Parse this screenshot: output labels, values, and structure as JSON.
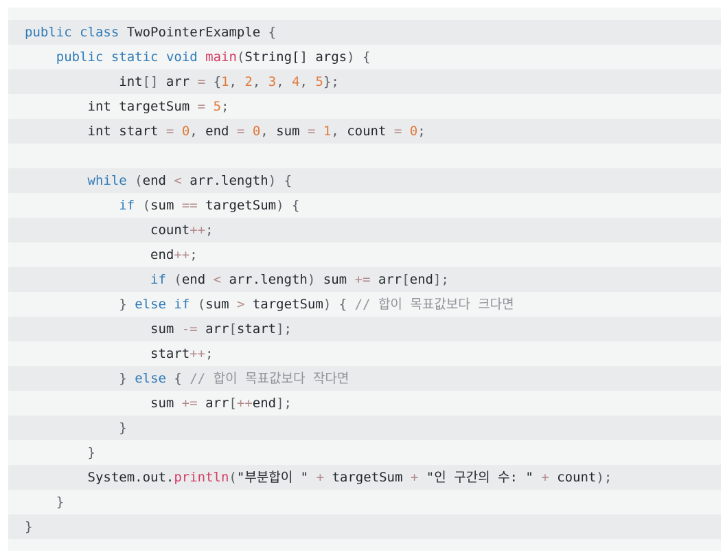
{
  "colors": {
    "background": "#f4f5f5",
    "shaded_line": "#eaebec",
    "keyword": "#2f7bb8",
    "function": "#d23c64",
    "number": "#e07a3c",
    "operator": "#b48a8a",
    "punctuation": "#5b6168",
    "comment": "#8f959b",
    "text": "#24292e"
  },
  "code": {
    "language": "java",
    "lines": [
      [
        {
          "t": "keyword",
          "v": "public"
        },
        {
          "t": "ident",
          "v": " "
        },
        {
          "t": "keyword",
          "v": "class"
        },
        {
          "t": "ident",
          "v": " TwoPointerExample "
        },
        {
          "t": "punct",
          "v": "{"
        }
      ],
      [
        {
          "t": "ident",
          "v": "    "
        },
        {
          "t": "keyword",
          "v": "public"
        },
        {
          "t": "ident",
          "v": " "
        },
        {
          "t": "keyword",
          "v": "static"
        },
        {
          "t": "ident",
          "v": " "
        },
        {
          "t": "keyword",
          "v": "void"
        },
        {
          "t": "ident",
          "v": " "
        },
        {
          "t": "func",
          "v": "main"
        },
        {
          "t": "punct",
          "v": "("
        },
        {
          "t": "ident",
          "v": "String[] args"
        },
        {
          "t": "punct",
          "v": ")"
        },
        {
          "t": "ident",
          "v": " "
        },
        {
          "t": "punct",
          "v": "{"
        }
      ],
      [
        {
          "t": "ident",
          "v": "            int"
        },
        {
          "t": "punct",
          "v": "[]"
        },
        {
          "t": "ident",
          "v": " arr "
        },
        {
          "t": "op",
          "v": "="
        },
        {
          "t": "ident",
          "v": " "
        },
        {
          "t": "punct",
          "v": "{"
        },
        {
          "t": "number",
          "v": "1"
        },
        {
          "t": "punct",
          "v": ", "
        },
        {
          "t": "number",
          "v": "2"
        },
        {
          "t": "punct",
          "v": ", "
        },
        {
          "t": "number",
          "v": "3"
        },
        {
          "t": "punct",
          "v": ", "
        },
        {
          "t": "number",
          "v": "4"
        },
        {
          "t": "punct",
          "v": ", "
        },
        {
          "t": "number",
          "v": "5"
        },
        {
          "t": "punct",
          "v": "};"
        }
      ],
      [
        {
          "t": "ident",
          "v": "        int targetSum "
        },
        {
          "t": "op",
          "v": "="
        },
        {
          "t": "ident",
          "v": " "
        },
        {
          "t": "number",
          "v": "5"
        },
        {
          "t": "punct",
          "v": ";"
        }
      ],
      [
        {
          "t": "ident",
          "v": "        int start "
        },
        {
          "t": "op",
          "v": "="
        },
        {
          "t": "ident",
          "v": " "
        },
        {
          "t": "number",
          "v": "0"
        },
        {
          "t": "punct",
          "v": ","
        },
        {
          "t": "ident",
          "v": " end "
        },
        {
          "t": "op",
          "v": "="
        },
        {
          "t": "ident",
          "v": " "
        },
        {
          "t": "number",
          "v": "0"
        },
        {
          "t": "punct",
          "v": ","
        },
        {
          "t": "ident",
          "v": " sum "
        },
        {
          "t": "op",
          "v": "="
        },
        {
          "t": "ident",
          "v": " "
        },
        {
          "t": "number",
          "v": "1"
        },
        {
          "t": "punct",
          "v": ","
        },
        {
          "t": "ident",
          "v": " count "
        },
        {
          "t": "op",
          "v": "="
        },
        {
          "t": "ident",
          "v": " "
        },
        {
          "t": "number",
          "v": "0"
        },
        {
          "t": "punct",
          "v": ";"
        }
      ],
      [],
      [
        {
          "t": "ident",
          "v": "        "
        },
        {
          "t": "keyword",
          "v": "while"
        },
        {
          "t": "ident",
          "v": " "
        },
        {
          "t": "punct",
          "v": "("
        },
        {
          "t": "ident",
          "v": "end "
        },
        {
          "t": "op",
          "v": "<"
        },
        {
          "t": "ident",
          "v": " arr.length"
        },
        {
          "t": "punct",
          "v": ")"
        },
        {
          "t": "ident",
          "v": " "
        },
        {
          "t": "punct",
          "v": "{"
        }
      ],
      [
        {
          "t": "ident",
          "v": "            "
        },
        {
          "t": "keyword",
          "v": "if"
        },
        {
          "t": "ident",
          "v": " "
        },
        {
          "t": "punct",
          "v": "("
        },
        {
          "t": "ident",
          "v": "sum "
        },
        {
          "t": "op",
          "v": "=="
        },
        {
          "t": "ident",
          "v": " targetSum"
        },
        {
          "t": "punct",
          "v": ")"
        },
        {
          "t": "ident",
          "v": " "
        },
        {
          "t": "punct",
          "v": "{"
        }
      ],
      [
        {
          "t": "ident",
          "v": "                count"
        },
        {
          "t": "op",
          "v": "++"
        },
        {
          "t": "punct",
          "v": ";"
        }
      ],
      [
        {
          "t": "ident",
          "v": "                end"
        },
        {
          "t": "op",
          "v": "++"
        },
        {
          "t": "punct",
          "v": ";"
        }
      ],
      [
        {
          "t": "ident",
          "v": "                "
        },
        {
          "t": "keyword",
          "v": "if"
        },
        {
          "t": "ident",
          "v": " "
        },
        {
          "t": "punct",
          "v": "("
        },
        {
          "t": "ident",
          "v": "end "
        },
        {
          "t": "op",
          "v": "<"
        },
        {
          "t": "ident",
          "v": " arr.length"
        },
        {
          "t": "punct",
          "v": ")"
        },
        {
          "t": "ident",
          "v": " sum "
        },
        {
          "t": "op",
          "v": "+="
        },
        {
          "t": "ident",
          "v": " arr"
        },
        {
          "t": "punct",
          "v": "["
        },
        {
          "t": "ident",
          "v": "end"
        },
        {
          "t": "punct",
          "v": "];"
        }
      ],
      [
        {
          "t": "ident",
          "v": "            "
        },
        {
          "t": "punct",
          "v": "}"
        },
        {
          "t": "ident",
          "v": " "
        },
        {
          "t": "keyword",
          "v": "else"
        },
        {
          "t": "ident",
          "v": " "
        },
        {
          "t": "keyword",
          "v": "if"
        },
        {
          "t": "ident",
          "v": " "
        },
        {
          "t": "punct",
          "v": "("
        },
        {
          "t": "ident",
          "v": "sum "
        },
        {
          "t": "op",
          "v": ">"
        },
        {
          "t": "ident",
          "v": " targetSum"
        },
        {
          "t": "punct",
          "v": ")"
        },
        {
          "t": "ident",
          "v": " "
        },
        {
          "t": "punct",
          "v": "{"
        },
        {
          "t": "ident",
          "v": " "
        },
        {
          "t": "comment",
          "v": "// 합이 목표값보다 크다면"
        }
      ],
      [
        {
          "t": "ident",
          "v": "                sum "
        },
        {
          "t": "op",
          "v": "-="
        },
        {
          "t": "ident",
          "v": " arr"
        },
        {
          "t": "punct",
          "v": "["
        },
        {
          "t": "ident",
          "v": "start"
        },
        {
          "t": "punct",
          "v": "];"
        }
      ],
      [
        {
          "t": "ident",
          "v": "                start"
        },
        {
          "t": "op",
          "v": "++"
        },
        {
          "t": "punct",
          "v": ";"
        }
      ],
      [
        {
          "t": "ident",
          "v": "            "
        },
        {
          "t": "punct",
          "v": "}"
        },
        {
          "t": "ident",
          "v": " "
        },
        {
          "t": "keyword",
          "v": "else"
        },
        {
          "t": "ident",
          "v": " "
        },
        {
          "t": "punct",
          "v": "{"
        },
        {
          "t": "ident",
          "v": " "
        },
        {
          "t": "comment",
          "v": "// 합이 목표값보다 작다면"
        }
      ],
      [
        {
          "t": "ident",
          "v": "                sum "
        },
        {
          "t": "op",
          "v": "+="
        },
        {
          "t": "ident",
          "v": " arr"
        },
        {
          "t": "punct",
          "v": "["
        },
        {
          "t": "op",
          "v": "++"
        },
        {
          "t": "ident",
          "v": "end"
        },
        {
          "t": "punct",
          "v": "];"
        }
      ],
      [
        {
          "t": "ident",
          "v": "            "
        },
        {
          "t": "punct",
          "v": "}"
        }
      ],
      [
        {
          "t": "ident",
          "v": "        "
        },
        {
          "t": "punct",
          "v": "}"
        }
      ],
      [
        {
          "t": "ident",
          "v": "        System.out."
        },
        {
          "t": "func",
          "v": "println"
        },
        {
          "t": "punct",
          "v": "("
        },
        {
          "t": "string",
          "v": "\"부분합이 \""
        },
        {
          "t": "ident",
          "v": " "
        },
        {
          "t": "op",
          "v": "+"
        },
        {
          "t": "ident",
          "v": " targetSum "
        },
        {
          "t": "op",
          "v": "+"
        },
        {
          "t": "ident",
          "v": " "
        },
        {
          "t": "string",
          "v": "\"인 구간의 수: \""
        },
        {
          "t": "ident",
          "v": " "
        },
        {
          "t": "op",
          "v": "+"
        },
        {
          "t": "ident",
          "v": " count"
        },
        {
          "t": "punct",
          "v": ");"
        }
      ],
      [
        {
          "t": "ident",
          "v": "    "
        },
        {
          "t": "punct",
          "v": "}"
        }
      ],
      [
        {
          "t": "punct",
          "v": "}"
        }
      ]
    ]
  }
}
